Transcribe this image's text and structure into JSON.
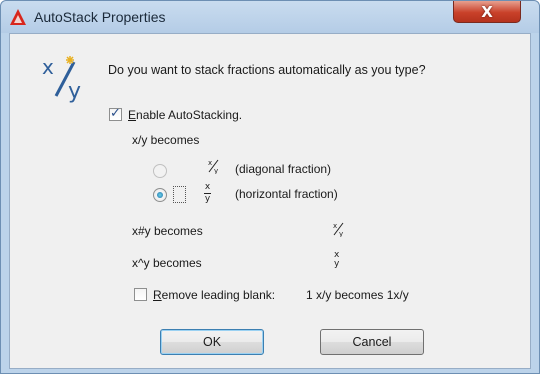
{
  "window": {
    "title": "AutoStack Properties",
    "close_label": "X"
  },
  "dialog": {
    "question": "Do you want to stack fractions automatically as you type?",
    "enable_label": "Enable AutoStacking.",
    "enable_checked": true,
    "xy_becomes_label": "x/y becomes",
    "options": [
      {
        "label": "(diagonal fraction)",
        "selected": false
      },
      {
        "label": "(horizontal fraction)",
        "selected": true
      }
    ],
    "hash_becomes_label": "x#y becomes",
    "caret_becomes_label": "x^y becomes",
    "remove_blank_label": "Remove leading blank:",
    "remove_blank_example": "1 x/y  becomes  1x/y",
    "remove_blank_checked": false
  },
  "buttons": {
    "ok_label": "OK",
    "cancel_label": "Cancel"
  },
  "colors": {
    "title_bar": "#bcd3ea",
    "close_button": "#c9412a",
    "client_bg": "#f0f0f0",
    "default_button_border": "#3c7fb1"
  }
}
